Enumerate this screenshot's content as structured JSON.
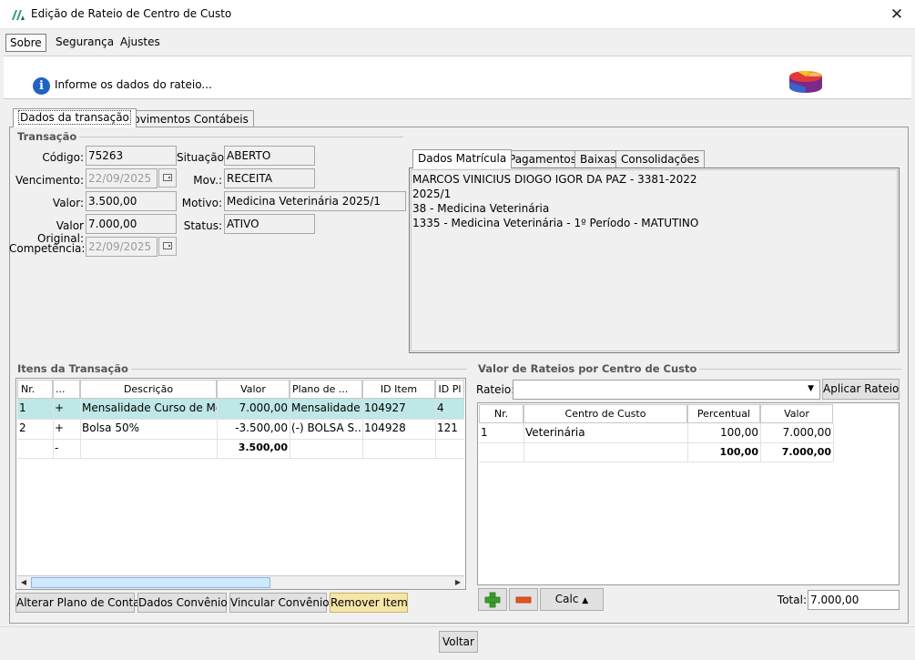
{
  "window": {
    "title": "Edição de Rateio de Centro de Custo",
    "close_glyph": "✕"
  },
  "menu": [
    {
      "label": "Sobre"
    },
    {
      "label": "Segurança"
    },
    {
      "label": "Ajustes"
    }
  ],
  "banner": {
    "text": "Informe os dados do rateio...",
    "info_glyph": "i"
  },
  "main_tabs": [
    {
      "label": "Dados da transação",
      "selected": true
    },
    {
      "label": "Movimentos Contábeis",
      "selected": false
    }
  ],
  "transacao": {
    "group_title": "Transação",
    "codigo": {
      "label": "Código:",
      "value": "75263"
    },
    "vencimento": {
      "label": "Vencimento:",
      "value": "22/09/2025"
    },
    "valor": {
      "label": "Valor:",
      "value": "3.500,00"
    },
    "valor_original": {
      "label": "Valor Original:",
      "value": "7.000,00"
    },
    "competencia": {
      "label": "Competência:",
      "value": "22/09/2025"
    },
    "situacao": {
      "label": "Situação:",
      "value": "ABERTO"
    },
    "mov": {
      "label": "Mov.:",
      "value": "RECEITA"
    },
    "motivo": {
      "label": "Motivo:",
      "value": "Medicina Veterinária 2025/1"
    },
    "status": {
      "label": "Status:",
      "value": "ATIVO"
    }
  },
  "sub_tabs": [
    {
      "label": "Dados Matrícula",
      "selected": true
    },
    {
      "label": "Pagamentos",
      "selected": false
    },
    {
      "label": "Baixas",
      "selected": false
    },
    {
      "label": "Consolidações",
      "selected": false
    }
  ],
  "matricula_lines": [
    "MARCOS VINICIUS DIOGO IGOR DA PAZ - 3381-2022",
    "2025/1",
    "38 - Medicina Veterinária",
    "1335 - Medicina Veterinária - 1º Período - MATUTINO"
  ],
  "itens": {
    "group_title": "Itens da Transação",
    "columns": [
      "Nr.",
      "...",
      "Descrição",
      "Valor",
      "Plano de ...",
      "ID Item",
      "ID Pl"
    ],
    "rows": [
      [
        "1",
        "+",
        "Mensalidade Curso de Me...",
        "7.000,00",
        "Mensalidade",
        "104927",
        "4"
      ],
      [
        "2",
        "+",
        "Bolsa 50%",
        "-3.500,00",
        "(-) BOLSA S...",
        "104928",
        "121"
      ]
    ],
    "total_row": [
      "",
      "-",
      "",
      "3.500,00",
      "",
      "",
      ""
    ]
  },
  "item_buttons": [
    {
      "label": "Alterar Plano de Conta"
    },
    {
      "label": "Dados Convênio"
    },
    {
      "label": "Vincular Convênio"
    },
    {
      "label": "Remover Item"
    }
  ],
  "scroll": {
    "left_glyph": "◀",
    "right_glyph": "▶"
  },
  "rateios": {
    "group_title": "Valor de Rateios por Centro de Custo",
    "combo_label": "Rateio:",
    "combo_value": "",
    "combo_arrow": "▼",
    "apply_label": "Aplicar Rateio",
    "columns": [
      "Nr.",
      "Centro de Custo",
      "Percentual",
      "Valor"
    ],
    "rows": [
      [
        "1",
        "Veterinária",
        "100,00",
        "7.000,00"
      ]
    ],
    "total_row": [
      "",
      "",
      "100,00",
      "7.000,00"
    ],
    "calc_label": "Calc",
    "calc_arrow": "▲",
    "total_label": "Total:",
    "total_value": "7.000,00"
  },
  "footer": {
    "voltar_label": "Voltar"
  },
  "colors": {
    "selected_row": "#bfe7e7",
    "highlight_button": "#f5e6a8",
    "info_blue": "#1f63c4"
  }
}
